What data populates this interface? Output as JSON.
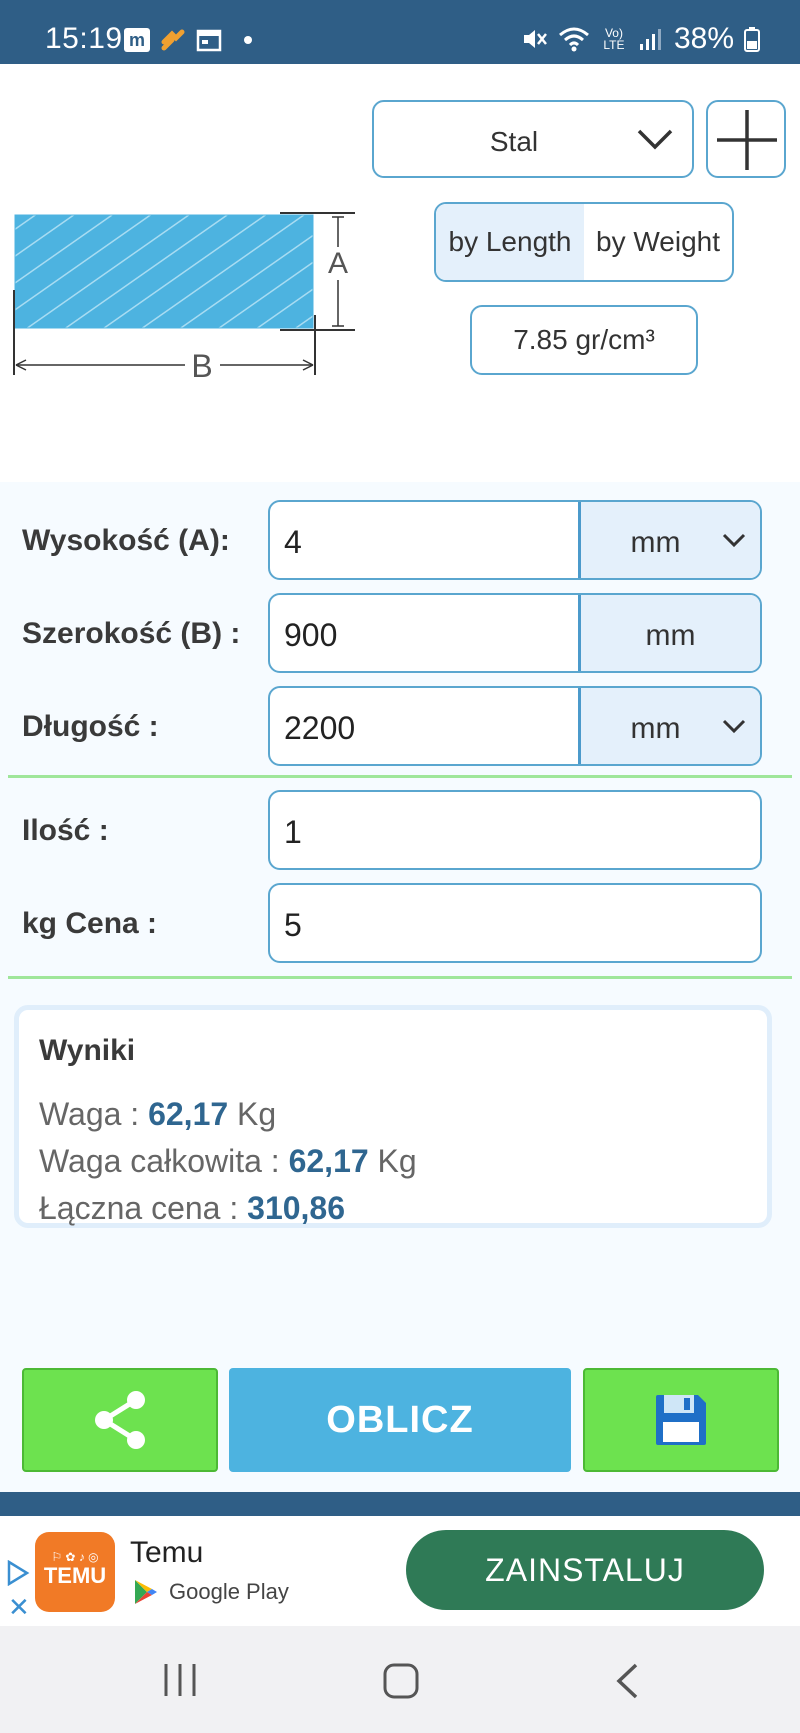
{
  "status_bar": {
    "time": "15:19",
    "battery": "38%",
    "network": "Vo) LTE"
  },
  "app_icons": [
    "m"
  ],
  "shape_labels": {
    "height": "A",
    "width": "B"
  },
  "material": {
    "selected": "Stal"
  },
  "mode_toggle": {
    "length_label": "by Length",
    "weight_label": "by Weight",
    "active": "by Length"
  },
  "density": "7.85 gr/cm³",
  "form": {
    "height": {
      "label": "Wysokość (A):",
      "value": "4",
      "unit": "mm"
    },
    "width": {
      "label": "Szerokość (B) :",
      "value": "900",
      "unit": "mm"
    },
    "length": {
      "label": "Długość :",
      "value": "2200",
      "unit": "mm"
    },
    "quantity": {
      "label": "Ilość :",
      "value": "1"
    },
    "price": {
      "label": "kg Cena :",
      "value": "5"
    }
  },
  "results": {
    "title": "Wyniki",
    "weight_label": "Waga :",
    "weight_value": "62,17",
    "weight_unit": "Kg",
    "total_weight_label": "Waga całkowita :",
    "total_weight_value": "62,17",
    "total_weight_unit": "Kg",
    "total_price_label": "Łączna cena :",
    "total_price_value": "310,86"
  },
  "actions": {
    "calculate_label": "OBLICZ"
  },
  "ad": {
    "app_name": "Temu",
    "logo_text": "TEMU",
    "store": "Google Play",
    "install_label": "ZAINSTALUJ"
  },
  "colors": {
    "primary": "#2f5e86",
    "accent_blue": "#4db3e0",
    "accent_green": "#6de24f",
    "value_blue": "#2f6690",
    "ad_button": "#2f7a56"
  }
}
